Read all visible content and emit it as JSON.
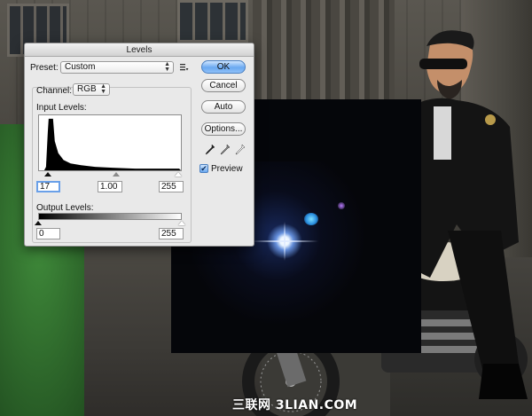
{
  "dialog": {
    "title": "Levels",
    "preset_label": "Preset:",
    "preset_value": "Custom",
    "channel_label": "Channel:",
    "channel_value": "RGB",
    "input_levels_label": "Input Levels:",
    "input_black": "17",
    "input_gamma": "1.00",
    "input_white": "255",
    "output_levels_label": "Output Levels:",
    "output_black": "0",
    "output_white": "255",
    "buttons": {
      "ok": "OK",
      "reset": "Cancel",
      "auto": "Auto",
      "options": "Options..."
    },
    "preview_label": "Preview",
    "preview_checked": true
  },
  "icons": [
    "preset-options-icon",
    "black-eyedropper-icon",
    "gray-eyedropper-icon",
    "white-eyedropper-icon",
    "checkmark-icon"
  ],
  "colors": {
    "default_button": "#6aa8f0",
    "dialog_bg": "#e9e9e9",
    "flare_core": "#eaf4ff"
  },
  "watermark": "三联网 3LIAN.COM"
}
